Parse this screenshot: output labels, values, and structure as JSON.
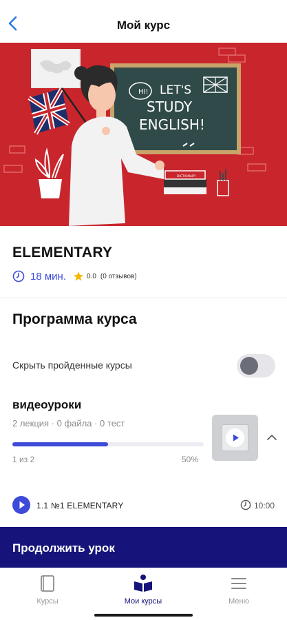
{
  "header": {
    "title": "Мой курс"
  },
  "banner": {
    "speech": "HI!",
    "board_line1": "LET'S",
    "board_line2": "STUDY",
    "board_line3": "ENGLISH!",
    "book_label": "DICTIONARY"
  },
  "course": {
    "name": "ELEMENTARY",
    "duration": "18 мин.",
    "rating": "0.0",
    "reviews": "(0 отзывов)"
  },
  "program": {
    "title": "Программа курса",
    "hide_completed_label": "Скрыть пройденные курсы",
    "hide_completed_on": false
  },
  "section": {
    "title": "видеоуроки",
    "stats": "2 лекция · 0 файла · 0 тест",
    "progress_count": "1 из 2",
    "progress_percent": "50%",
    "progress_fraction": 0.5
  },
  "lesson": {
    "title": "1.1 №1 ELEMENTARY",
    "time": "10:00"
  },
  "cta": {
    "label": "Продолжить урок"
  },
  "tabs": [
    {
      "label": "Курсы",
      "icon": "book-icon",
      "active": false
    },
    {
      "label": "Мои курсы",
      "icon": "open-book-icon",
      "active": true
    },
    {
      "label": "Меню",
      "icon": "hamburger-icon",
      "active": false
    }
  ],
  "colors": {
    "accent": "#3d4bd8",
    "cta": "#16137a",
    "banner": "#c8262c",
    "chalkboard": "#2f4a48"
  }
}
